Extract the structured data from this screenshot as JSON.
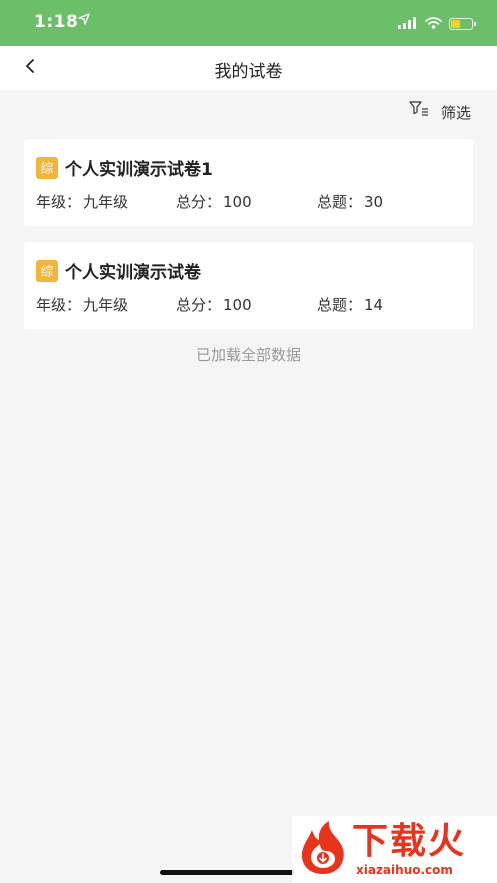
{
  "status_bar": {
    "time": "1:18",
    "location_icon": "location-arrow-icon",
    "signal_icon": "signal-bars-icon",
    "wifi_icon": "wifi-icon",
    "battery_icon": "battery-icon",
    "battery_level": 0.45,
    "battery_color": "#f5d020",
    "bar_color": "#6cbf69"
  },
  "nav": {
    "title": "我的试卷",
    "back_icon": "chevron-left-icon"
  },
  "filter": {
    "label": "筛选",
    "icon": "filter-icon"
  },
  "papers": [
    {
      "badge": "综",
      "title": "个人实训演示试卷1",
      "grade_label": "年级：",
      "grade": "九年级",
      "score_label": "总分：",
      "score": "100",
      "count_label": "总题：",
      "count": "30"
    },
    {
      "badge": "综",
      "title": "个人实训演示试卷",
      "grade_label": "年级：",
      "grade": "九年级",
      "score_label": "总分：",
      "score": "100",
      "count_label": "总题：",
      "count": "14"
    }
  ],
  "list_footer": "已加载全部数据",
  "watermark": {
    "title": "下载火",
    "url": "xiazaihuo.com"
  },
  "colors": {
    "accent": "#6cbf69",
    "badge": "#f3b43a",
    "watermark": "#e8341c"
  }
}
